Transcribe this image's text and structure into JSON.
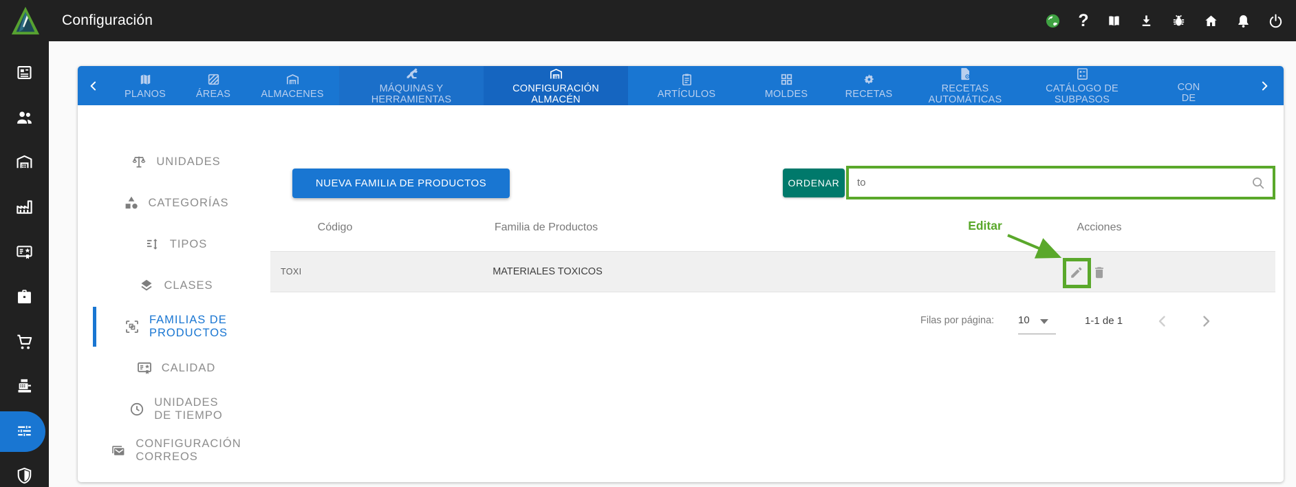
{
  "topbar": {
    "title": "Configuración",
    "icons": [
      "globe-icon",
      "help-icon",
      "manual-icon",
      "download-icon",
      "bug-report-icon",
      "home-icon",
      "notifications-icon",
      "power-icon"
    ]
  },
  "sidebar": {
    "icons": [
      "news-icon",
      "people-icon",
      "warehouse-icon",
      "factory-icon",
      "quality-icon",
      "briefcase-icon",
      "cart-icon",
      "cash-register-icon",
      "settings-icon",
      "security-icon"
    ],
    "active": "settings-icon"
  },
  "tabs": {
    "scroll_left": "‹",
    "scroll_right": "›",
    "items": [
      {
        "line1": "PLANOS",
        "line2": "",
        "icon": "map-icon",
        "active": false
      },
      {
        "line1": "ÁREAS",
        "line2": "",
        "icon": "area-icon",
        "active": false
      },
      {
        "line1": "ALMACENES",
        "line2": "",
        "icon": "warehouse-icon",
        "active": false
      },
      {
        "line1": "MÁQUINAS Y",
        "line2": "HERRAMIENTAS",
        "icon": "machines-icon",
        "active": false
      },
      {
        "line1": "CONFIGURACIÓN",
        "line2": "ALMACÉN",
        "icon": "warehouse-icon",
        "active": true
      },
      {
        "line1": "ARTÍCULOS",
        "line2": "",
        "icon": "clipboard-icon",
        "active": false
      },
      {
        "line1": "MOLDES",
        "line2": "",
        "icon": "grid-icon",
        "active": false
      },
      {
        "line1": "RECETAS",
        "line2": "",
        "icon": "gear-icon",
        "active": false
      },
      {
        "line1": "RECETAS",
        "line2": "AUTOMÁTICAS",
        "icon": "file-gear-icon",
        "active": false
      },
      {
        "line1": "CATÁLOGO DE",
        "line2": "SUBPASOS",
        "icon": "catalog-icon",
        "active": false
      },
      {
        "line1": "CON",
        "line2": "DE",
        "icon": "",
        "active": false,
        "truncated": true
      }
    ]
  },
  "menu": {
    "items": [
      {
        "line1": "UNIDADES",
        "line2": "",
        "icon": "scale-icon",
        "active": false
      },
      {
        "line1": "CATEGORÍAS",
        "line2": "",
        "icon": "category-icon",
        "active": false
      },
      {
        "line1": "TIPOS",
        "line2": "",
        "icon": "sort-icon",
        "active": false
      },
      {
        "line1": "CLASES",
        "line2": "",
        "icon": "layers-icon",
        "active": false
      },
      {
        "line1": "FAMILIAS DE",
        "line2": "PRODUCTOS",
        "icon": "products-family-icon",
        "active": true
      },
      {
        "line1": "CALIDAD",
        "line2": "",
        "icon": "quality-icon",
        "active": false
      },
      {
        "line1": "UNIDADES",
        "line2": "DE TIEMPO",
        "icon": "clock-icon",
        "active": false
      },
      {
        "line1": "CONFIGURACIÓN",
        "line2": "CORREOS",
        "icon": "mail-icon",
        "active": false
      }
    ]
  },
  "toolbar": {
    "new_button": "NUEVA FAMILIA DE PRODUCTOS",
    "order_button": "ORDENAR",
    "search_value": "to",
    "search_icon": "search-icon"
  },
  "table": {
    "headers": {
      "code": "Código",
      "family": "Familia de Productos",
      "actions": "Acciones"
    },
    "rows": [
      {
        "code": "TOXI",
        "family": "MATERIALES TOXICOS",
        "actions": [
          "edit-icon",
          "delete-icon"
        ]
      }
    ]
  },
  "annotation": {
    "label": "Editar",
    "color": "#5aa82b"
  },
  "pagination": {
    "rows_per_page_label": "Filas por página:",
    "rows_per_page": "10",
    "range": "1-1 de 1",
    "prev": "chevron-left-icon",
    "next": "chevron-right-icon"
  },
  "colors": {
    "primary": "#1976d2",
    "primary_dark": "#1565c0",
    "order_button": "#00796b",
    "topbar_bg": "#212121",
    "annotation_green": "#5aa82b",
    "row_bg": "#f0f0f0",
    "inactive_tab_text": "#b9cfee"
  }
}
